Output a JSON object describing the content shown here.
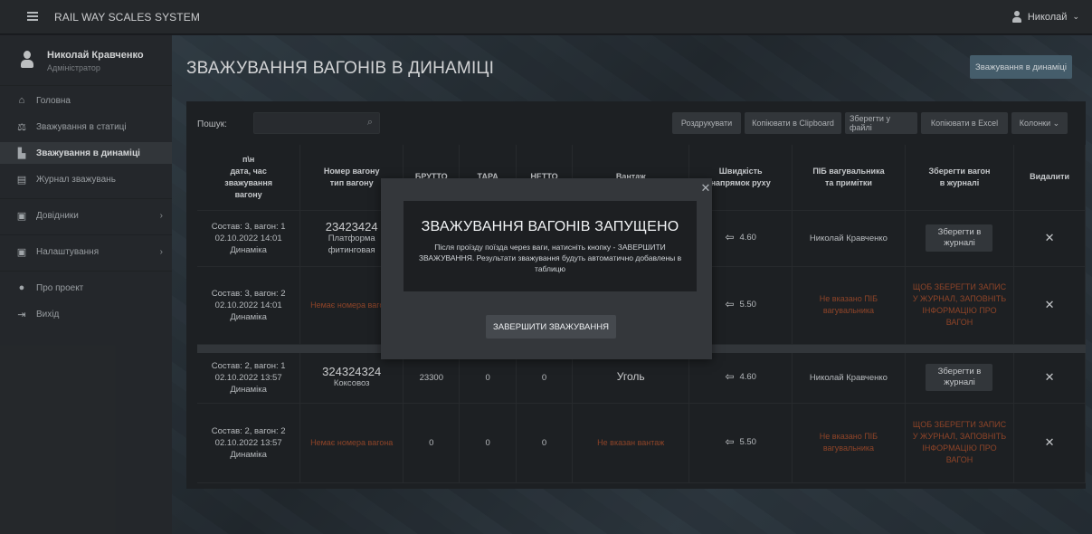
{
  "header": {
    "app_title": "RAIL WAY SCALES SYSTEM",
    "user_name": "Николай",
    "user_chevron": "⌄"
  },
  "sidebar": {
    "profile": {
      "name": "Николай Кравченко",
      "role": "Адміністратор"
    },
    "items": [
      {
        "label": "Головна",
        "icon": "home-icon"
      },
      {
        "label": "Зважування в статиці",
        "icon": "scales-icon"
      },
      {
        "label": "Зважування в динаміці",
        "icon": "train-icon"
      },
      {
        "label": "Журнал зважувань",
        "icon": "journal-icon"
      },
      {
        "label": "Довідники",
        "icon": "list-icon",
        "arrow": "›"
      },
      {
        "label": "Налаштування",
        "icon": "settings-list-icon",
        "arrow": "›"
      },
      {
        "label": "Про проект",
        "icon": "info-icon"
      },
      {
        "label": "Вихід",
        "icon": "logout-icon"
      }
    ]
  },
  "main": {
    "title": "ЗВАЖУВАННЯ ВАГОНІВ В ДИНАМІЦІ",
    "dynamic_button": "Зважування в динаміці",
    "search_label": "Пошук:",
    "search_value": "",
    "toolbar": {
      "print": "Роздрукувати",
      "copy_clipboard": "Копіювати в Clipboard",
      "save_file": "Зберегти у файлі",
      "copy_excel": "Копіювати в Excel",
      "columns": "Колонки ⌄"
    },
    "columns": {
      "c1_line1": "п\\н",
      "c1_line2": "дата, час",
      "c1_line3": "зважування",
      "c1_line4": "вагону",
      "c2_line1": "Номер вагону",
      "c2_line2": "тип вагону",
      "c3": "БРУТТО",
      "c4": "ТАРА",
      "c5": "НЕТТО",
      "c6": "Вантаж",
      "c7_line1": "Швидкість",
      "c7_line2": "напрямок руху",
      "c8_line1": "ПІБ вагувальника",
      "c8_line2": "та примітки",
      "c9_line1": "Зберегти вагон",
      "c9_line2": "в журналі",
      "c10": "Видалити"
    },
    "rows": [
      {
        "pos": "Состав: 3, вагон: 1",
        "datetime": "02.10.2022 14:01",
        "mode": "Динаміка",
        "wagon_no": "23423424",
        "wagon_type": "Платформа фитинговая",
        "brutto": "",
        "tara": "",
        "netto": "",
        "cargo": "",
        "speed": "4.60",
        "operator": "Николай Кравченко",
        "save": "Зберегти в журналі"
      },
      {
        "pos": "Состав: 3, вагон: 2",
        "datetime": "02.10.2022 14:01",
        "mode": "Динаміка",
        "wagon_warn": "Немає номера вагона",
        "brutto": "",
        "tara": "",
        "netto": "",
        "cargo": "",
        "speed": "5.50",
        "operator_warn": "Не вказано ПІБ вагувальника",
        "save_warn": "ЩОБ ЗБЕРЕГТИ ЗАПИС У ЖУРНАЛ, ЗАПОВНІТЬ ІНФОРМАЦІЮ ПРО ВАГОН"
      },
      {
        "pos": "Состав: 2, вагон: 1",
        "datetime": "02.10.2022 13:57",
        "mode": "Динаміка",
        "wagon_no": "324324324",
        "wagon_type": "Коксовоз",
        "brutto": "23300",
        "tara": "0",
        "netto": "0",
        "cargo": "Уголь",
        "speed": "4.60",
        "operator": "Николай Кравченко",
        "save": "Зберегти в журналі"
      },
      {
        "pos": "Состав: 2, вагон: 2",
        "datetime": "02.10.2022 13:57",
        "mode": "Динаміка",
        "wagon_warn": "Немає номера вагона",
        "brutto": "0",
        "tara": "0",
        "netto": "0",
        "cargo_warn": "Не вказан вантаж",
        "speed": "5.50",
        "operator_warn": "Не вказано ПІБ вагувальника",
        "save_warn": "ЩОБ ЗБЕРЕГТИ ЗАПИС У ЖУРНАЛ, ЗАПОВНІТЬ ІНФОРМАЦІЮ ПРО ВАГОН"
      }
    ],
    "delete_glyph": "✕",
    "direction_glyph": "⇦"
  },
  "modal": {
    "title": "ЗВАЖУВАННЯ ВАГОНІВ ЗАПУЩЕНО",
    "text": "Після проїзду поїзда через ваги, натисніть кнопку - ЗАВЕРШИТИ ЗВАЖУВАННЯ. Результати зважування будуть автоматично добавлены в таблицю",
    "button": "ЗАВЕРШИТИ ЗВАЖУВАННЯ",
    "close": "✕"
  },
  "colors": {
    "accent": "#4f6a7a",
    "warning": "#a24e2e",
    "sidebar_bg": "#2a2d31",
    "topbar_bg": "#2b2e32"
  }
}
